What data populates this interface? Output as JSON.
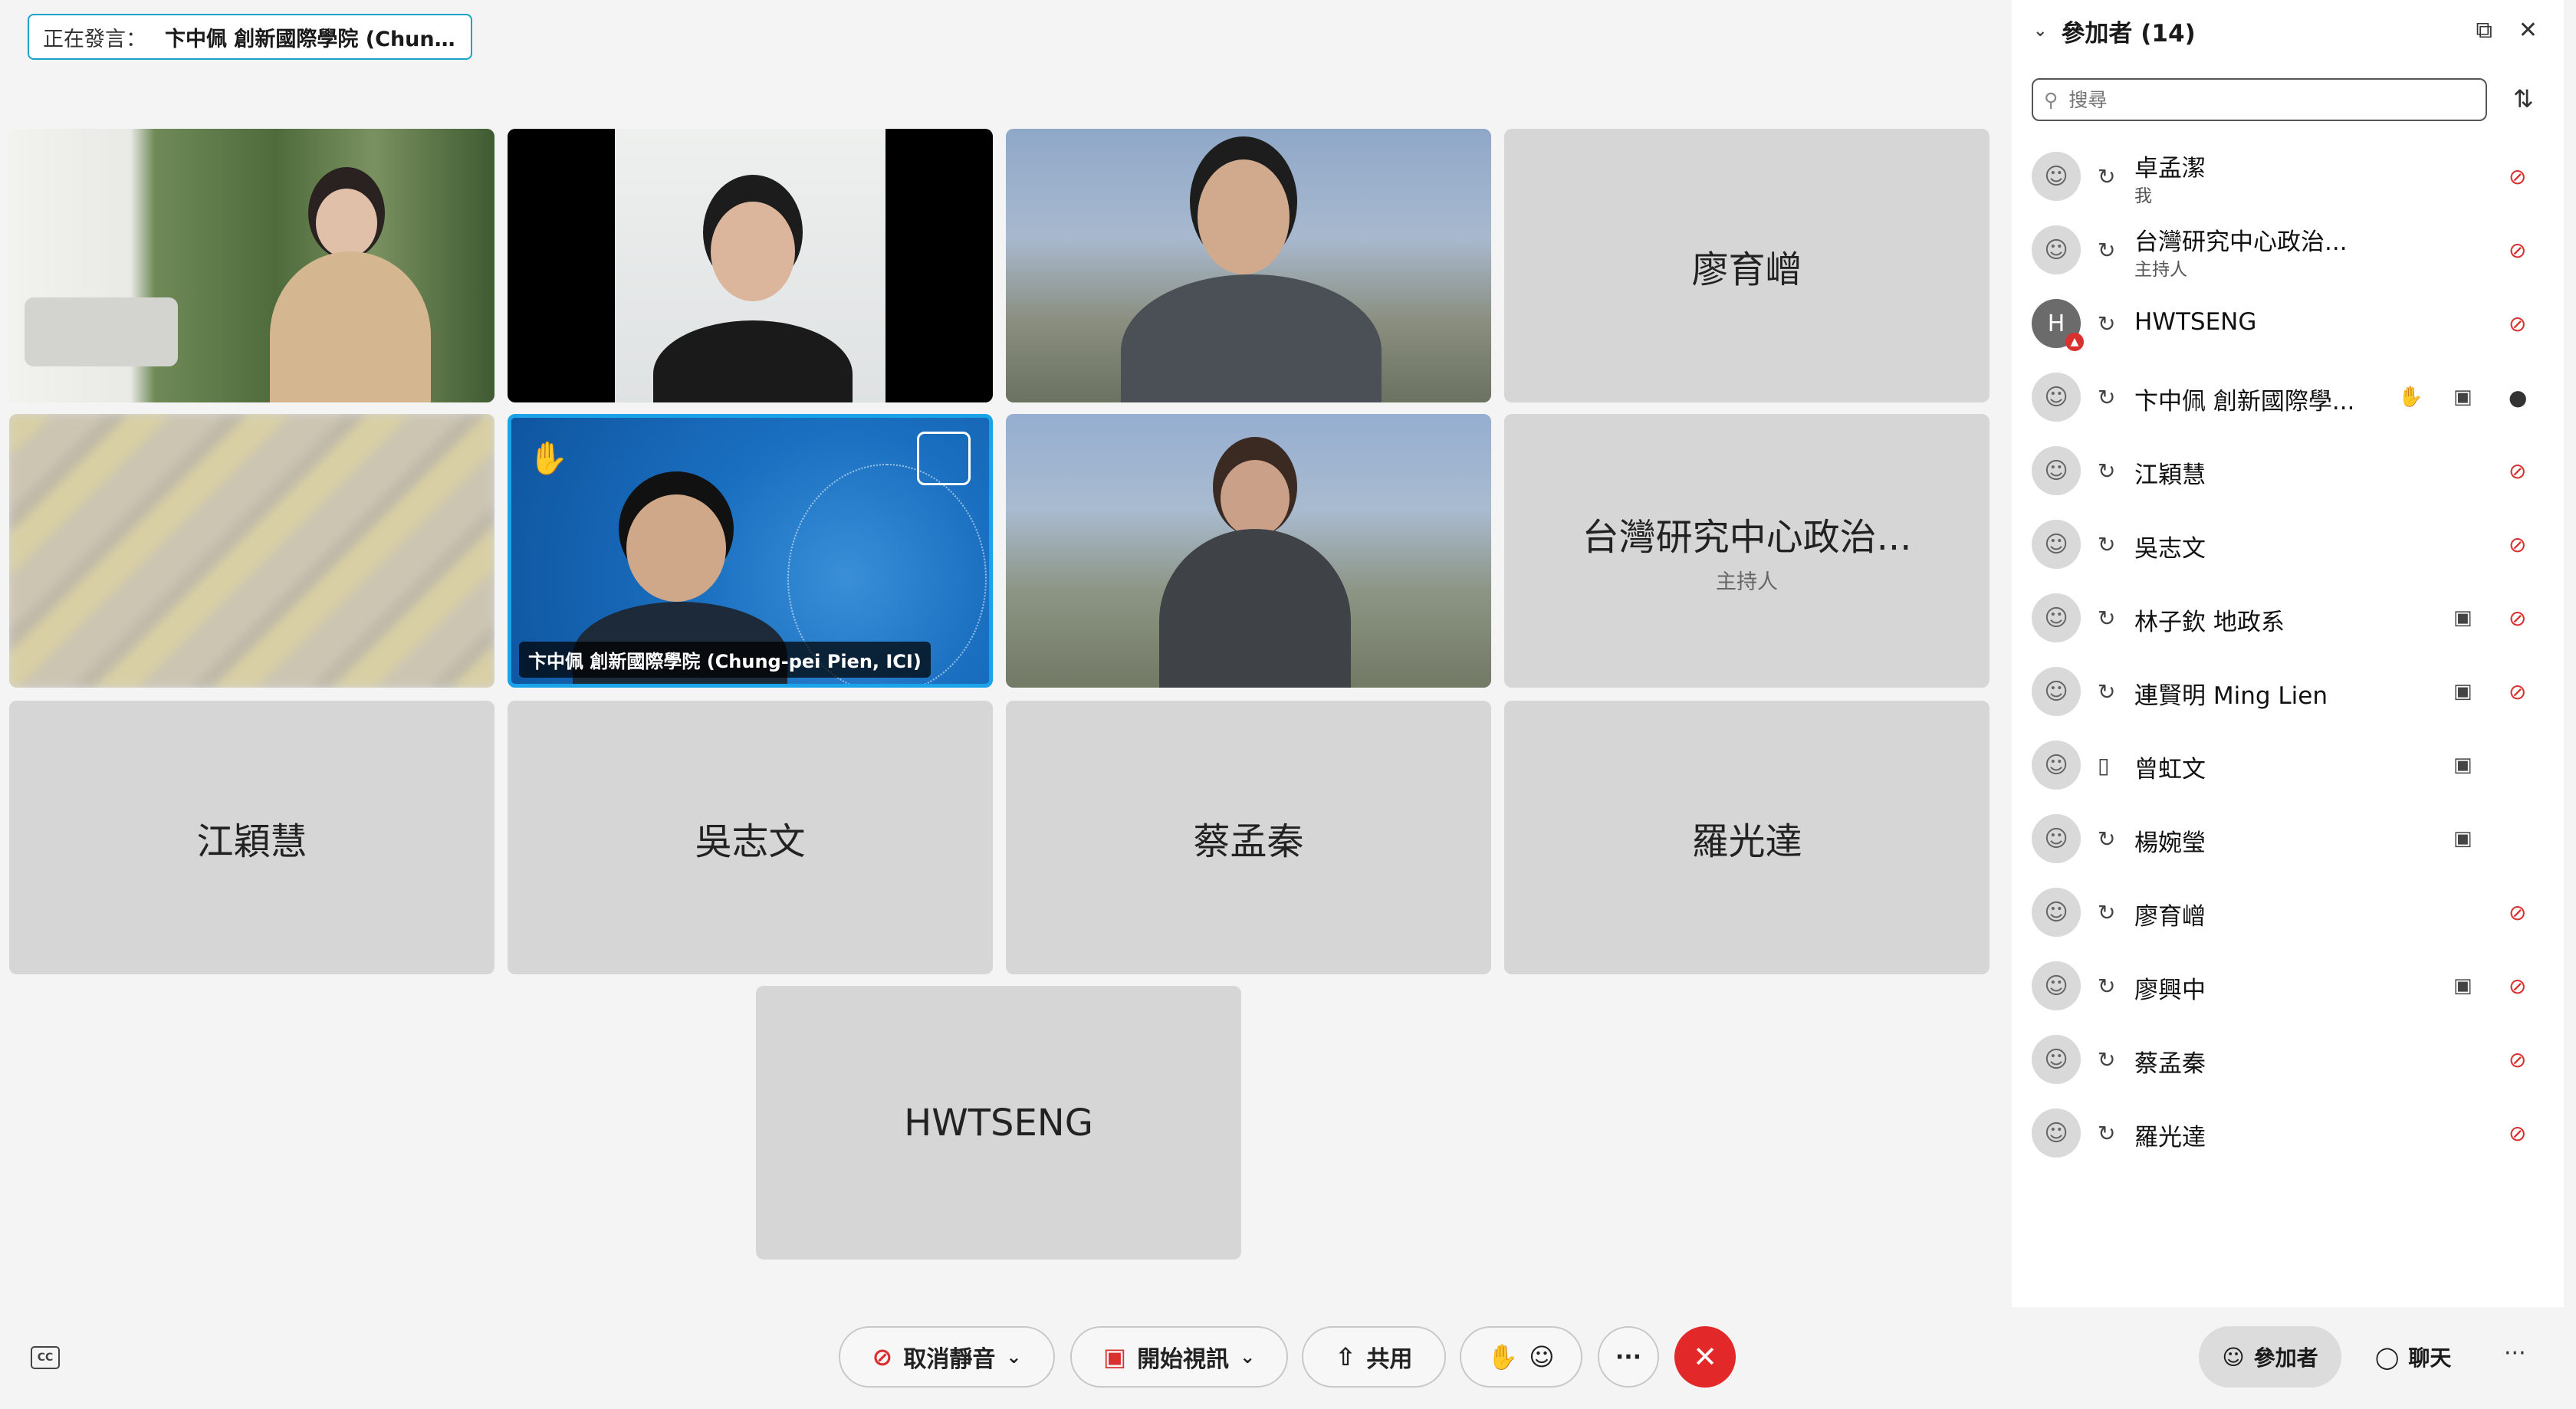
{
  "speaking": {
    "label": "正在發言：",
    "name": "卞中佩 創新國際學院 (Chun..."
  },
  "tiles": {
    "t3": {
      "name": "廖育嶒"
    },
    "t5": {
      "caption": "卞中佩 創新國際學院 (Chung-pei Pien, ICI)",
      "hand": "✋"
    },
    "t7": {
      "name": "台灣研究中心政治...",
      "role": "主持人"
    },
    "t8": {
      "name": "江穎慧"
    },
    "t9": {
      "name": "吳志文"
    },
    "t10": {
      "name": "蔡孟秦"
    },
    "t11": {
      "name": "羅光達"
    },
    "t12": {
      "name": "HWTSENG"
    }
  },
  "panel": {
    "title": "參加者 (14)",
    "search_placeholder": "搜尋",
    "participants": [
      {
        "name": "卓孟潔",
        "role": "我"
      },
      {
        "name": "台灣研究中心政治...",
        "role": "主持人"
      },
      {
        "name": "HWTSENG",
        "avatar": "H"
      },
      {
        "name": "卞中佩 創新國際學..."
      },
      {
        "name": "江穎慧"
      },
      {
        "name": "吳志文"
      },
      {
        "name": "林子欽 地政系"
      },
      {
        "name": "連賢明 Ming Lien"
      },
      {
        "name": "曾虹文"
      },
      {
        "name": "楊婉瑩"
      },
      {
        "name": "廖育嶒"
      },
      {
        "name": "廖興中"
      },
      {
        "name": "蔡孟秦"
      },
      {
        "name": "羅光達"
      }
    ]
  },
  "toolbar": {
    "unmute": "取消靜音",
    "start_video": "開始視訊",
    "share": "共用",
    "more": "···",
    "participants": "參加者",
    "chat": "聊天",
    "cc": "CC"
  },
  "colors": {
    "accent": "#1aa3e8",
    "end": "#e22828",
    "muted": "#d93030"
  }
}
